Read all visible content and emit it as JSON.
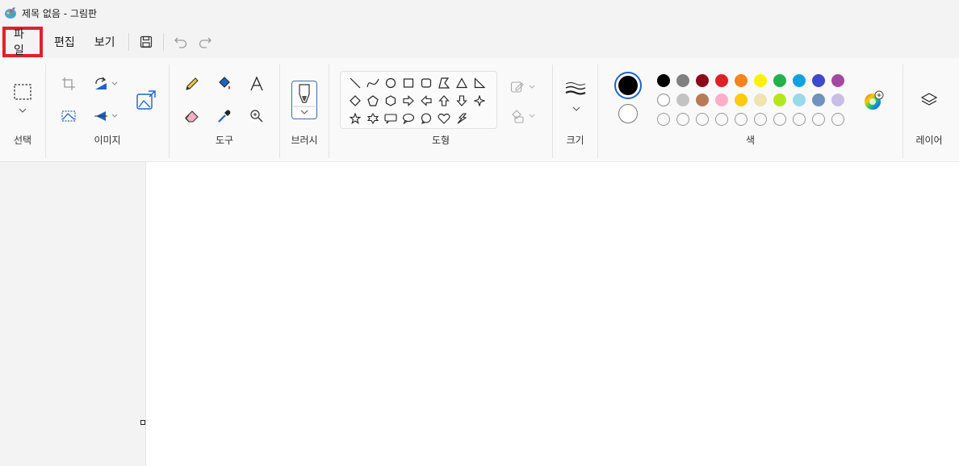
{
  "window": {
    "title": "제목 없음 - 그림판"
  },
  "menu": {
    "file": "파일",
    "edit": "편집",
    "view": "보기"
  },
  "ribbon": {
    "groups": {
      "selection": "선택",
      "image": "이미지",
      "tools": "도구",
      "brushes": "브러시",
      "shapes": "도형",
      "size": "크기",
      "colors": "색",
      "layers": "레이어"
    }
  },
  "colors": {
    "primary": "#000000",
    "secondary": "#ffffff",
    "palette_row1": [
      "#000000",
      "#808080",
      "#8b0a1a",
      "#e01f26",
      "#f7831e",
      "#fff200",
      "#22b14c",
      "#0fa0e0",
      "#3f48cc",
      "#a349a4"
    ],
    "palette_row2": [
      "#ffffff",
      "#c3c3c3",
      "#b97a57",
      "#ffaec9",
      "#ffc90e",
      "#efe4b0",
      "#b5e61d",
      "#99d9ea",
      "#7092be",
      "#c8bfe7"
    ],
    "highlight_border": "#e0202a"
  }
}
